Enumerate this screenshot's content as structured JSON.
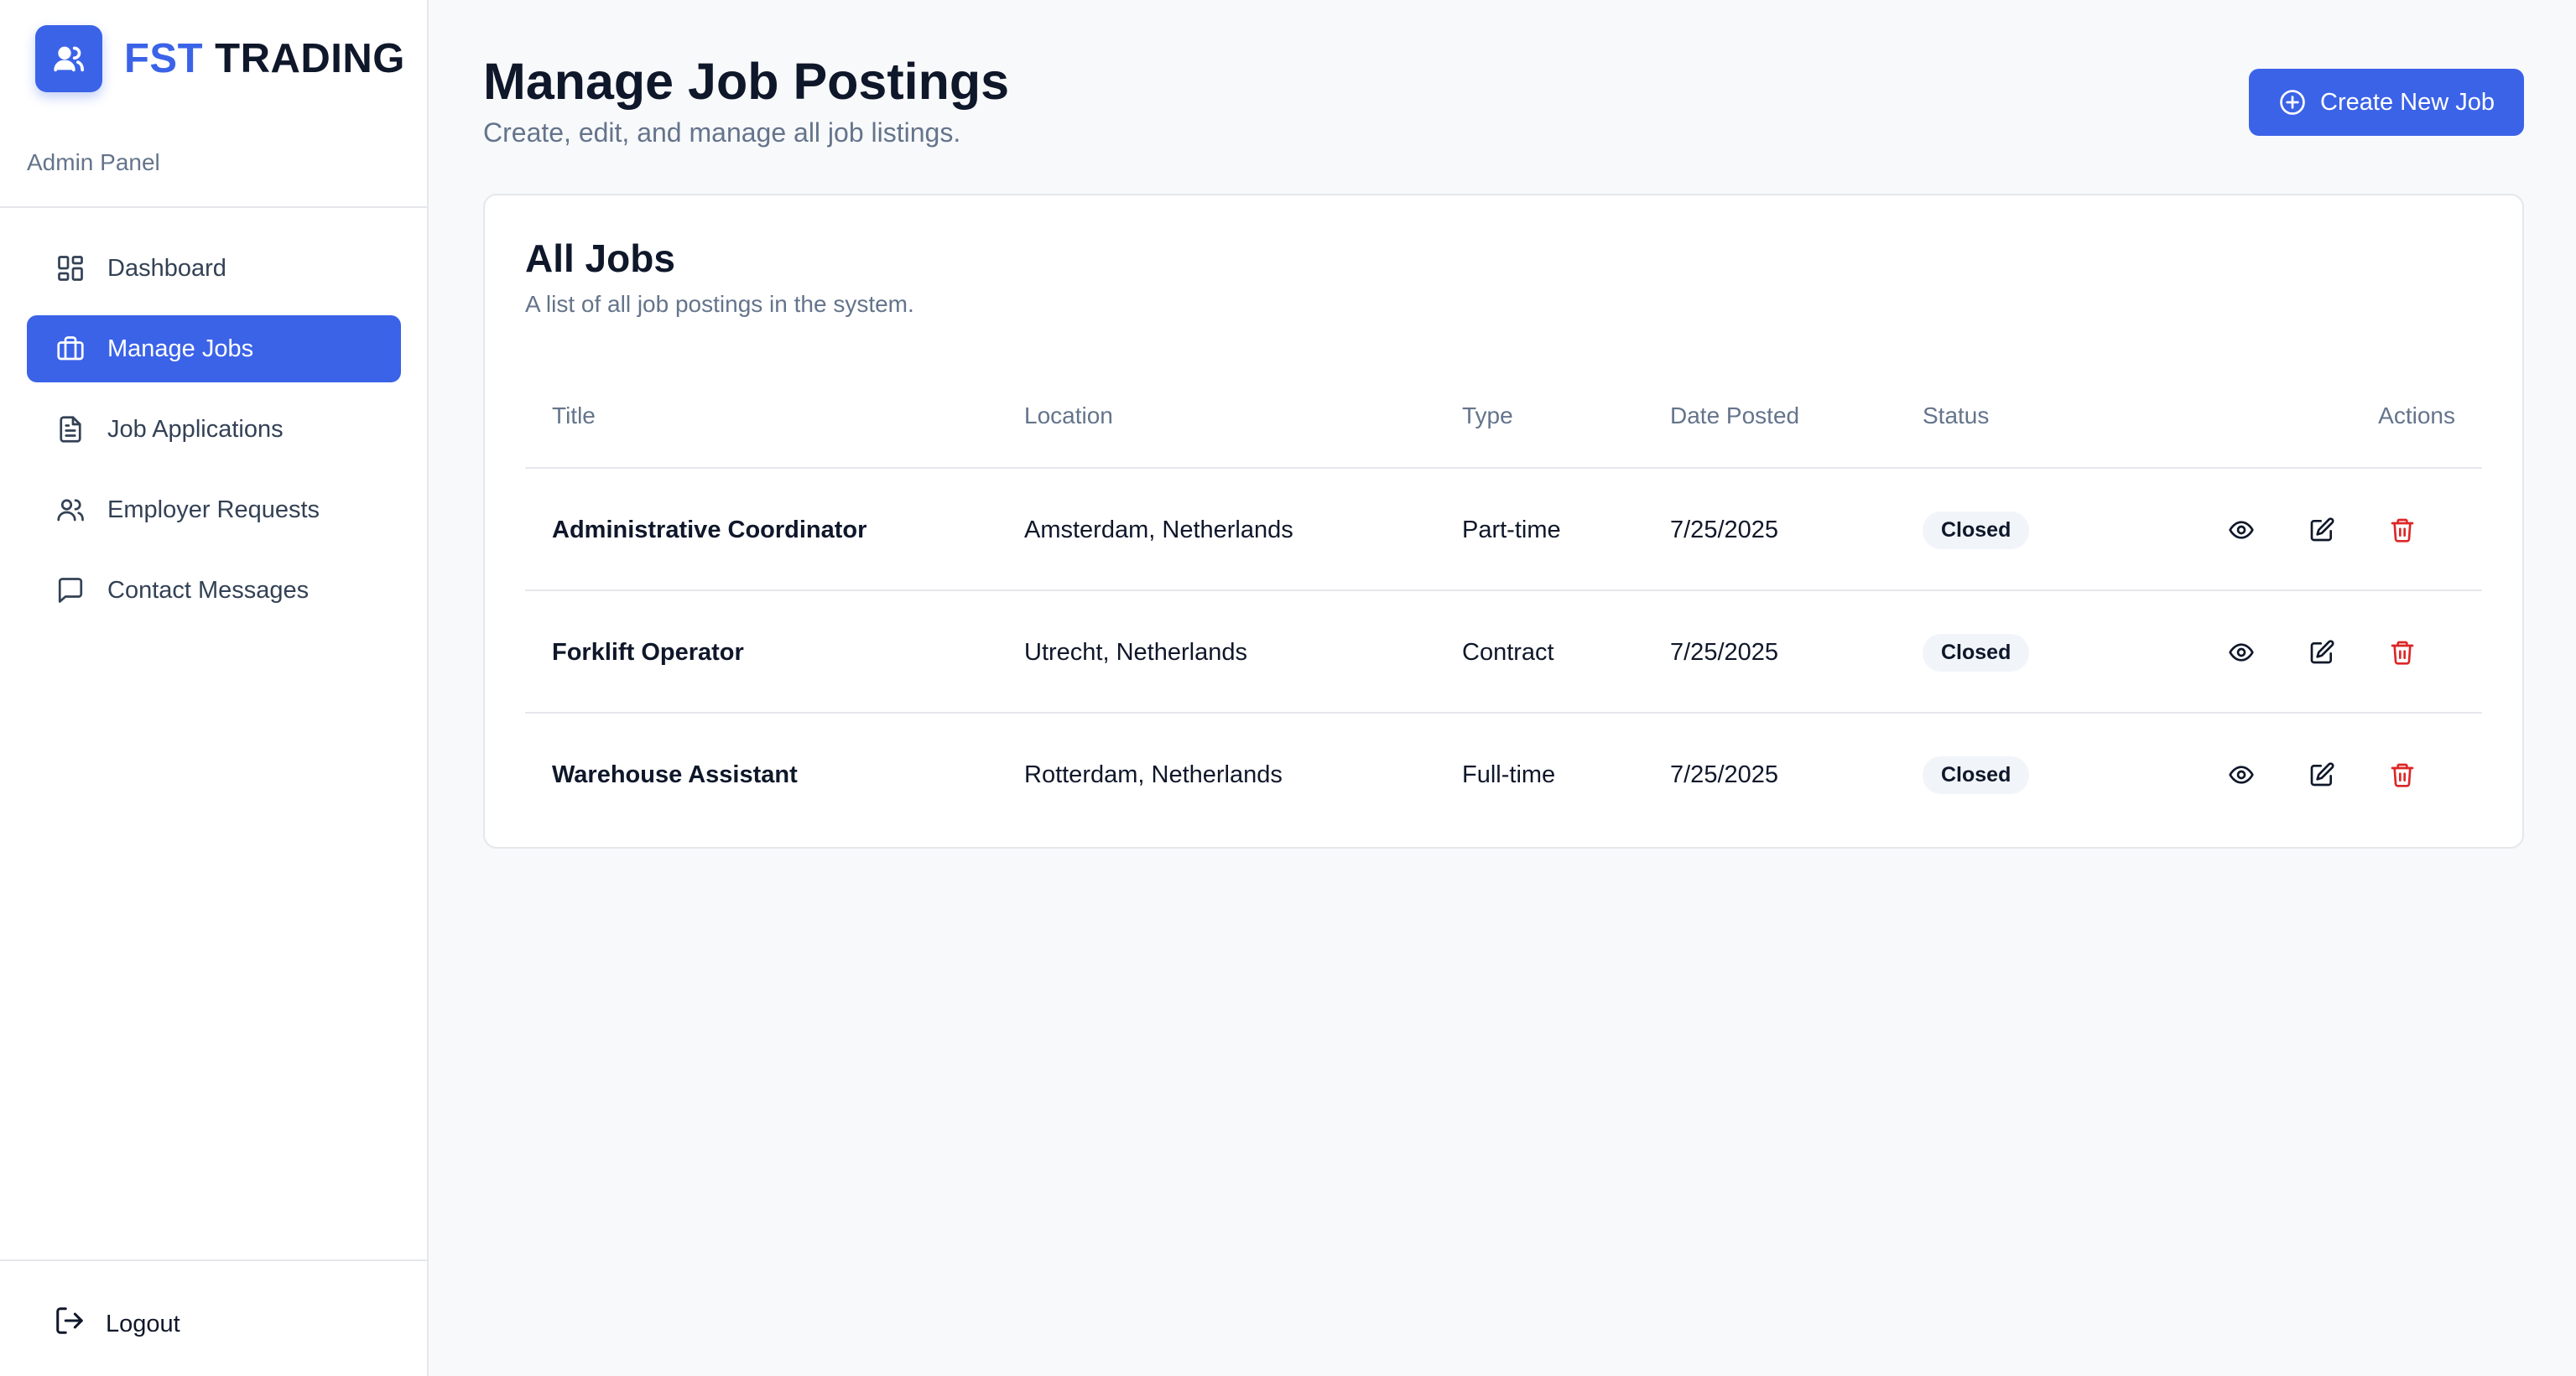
{
  "brand": {
    "accent": "FST",
    "rest": "TRADING",
    "color": "#3b63e8",
    "logo_icon": "users-icon"
  },
  "sidebar": {
    "panel_label": "Admin Panel",
    "items": [
      {
        "label": "Dashboard",
        "icon": "dashboard-grid-icon",
        "active": false
      },
      {
        "label": "Manage Jobs",
        "icon": "briefcase-icon",
        "active": true
      },
      {
        "label": "Job Applications",
        "icon": "document-icon",
        "active": false
      },
      {
        "label": "Employer Requests",
        "icon": "users-icon",
        "active": false
      },
      {
        "label": "Contact Messages",
        "icon": "message-icon",
        "active": false
      }
    ],
    "logout_label": "Logout"
  },
  "header": {
    "title": "Manage Job Postings",
    "subtitle": "Create, edit, and manage all job listings.",
    "create_label": "Create New Job"
  },
  "jobs_card": {
    "title": "All Jobs",
    "subtitle": "A list of all job postings in the system.",
    "columns": [
      "Title",
      "Location",
      "Type",
      "Date Posted",
      "Status",
      "Actions"
    ],
    "rows": [
      {
        "title": "Administrative Coordinator",
        "location": "Amsterdam, Netherlands",
        "type": "Part-time",
        "date": "7/25/2025",
        "status": "Closed"
      },
      {
        "title": "Forklift Operator",
        "location": "Utrecht, Netherlands",
        "type": "Contract",
        "date": "7/25/2025",
        "status": "Closed"
      },
      {
        "title": "Warehouse Assistant",
        "location": "Rotterdam, Netherlands",
        "type": "Full-time",
        "date": "7/25/2025",
        "status": "Closed"
      }
    ]
  },
  "colors": {
    "primary": "#3b63e8",
    "danger": "#dc2626",
    "muted": "#64748b"
  }
}
